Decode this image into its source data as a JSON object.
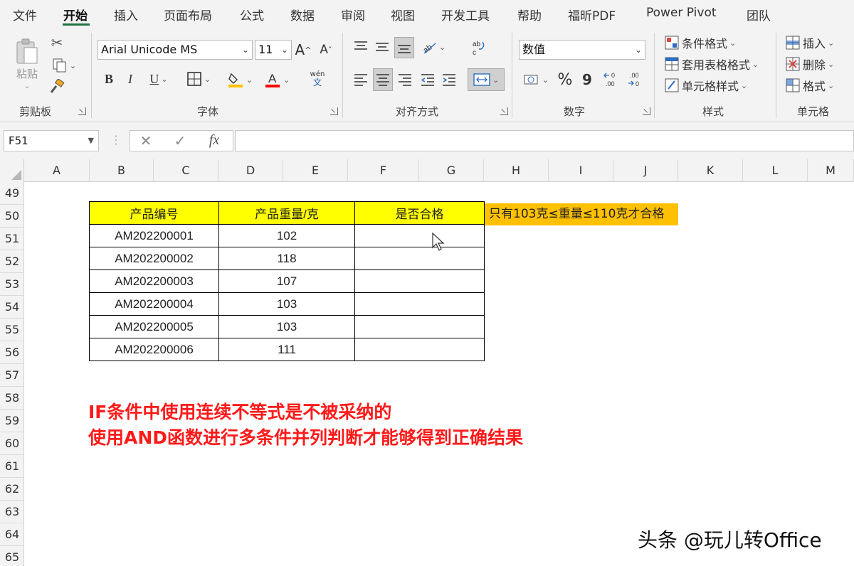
{
  "menu": {
    "tabs": [
      "文件",
      "开始",
      "插入",
      "页面布局",
      "公式",
      "数据",
      "审阅",
      "视图",
      "开发工具",
      "帮助",
      "福昕PDF",
      "Power Pivot",
      "团队"
    ],
    "active_index": 1
  },
  "ribbon": {
    "clipboard": {
      "group_label": "剪贴板",
      "paste_label": "粘贴"
    },
    "font": {
      "group_label": "字体",
      "font_name": "Arial Unicode MS",
      "font_size": "11",
      "bold": "B",
      "italic": "I",
      "underline": "U",
      "grow": "A",
      "shrink": "A",
      "wen": "wén",
      "wen_char": "文"
    },
    "alignment": {
      "group_label": "对齐方式"
    },
    "number": {
      "group_label": "数字",
      "format": "数值",
      "percent": "%",
      "comma": "9",
      "inc_decimal": "←0\n.00",
      "dec_decimal": ".00\n→0"
    },
    "styles": {
      "group_label": "样式",
      "conditional": "条件格式",
      "table": "套用表格格式",
      "cell_styles": "单元格样式"
    },
    "cells": {
      "group_label": "单元格",
      "insert": "插入",
      "delete": "删除",
      "format": "格式"
    }
  },
  "formula_bar": {
    "name_box": "F51",
    "fx": "fx",
    "value": ""
  },
  "columns": [
    "A",
    "B",
    "C",
    "D",
    "E",
    "F",
    "G",
    "H",
    "I",
    "J",
    "K",
    "L",
    "M"
  ],
  "rows": [
    "49",
    "50",
    "51",
    "52",
    "53",
    "54",
    "55",
    "56",
    "57",
    "58",
    "59",
    "60",
    "61",
    "62",
    "63",
    "64",
    "65"
  ],
  "table": {
    "headers": [
      "产品编号",
      "产品重量/克",
      "是否合格"
    ],
    "rows": [
      [
        "AM202200001",
        "102",
        ""
      ],
      [
        "AM202200002",
        "118",
        ""
      ],
      [
        "AM202200003",
        "107",
        ""
      ],
      [
        "AM202200004",
        "103",
        ""
      ],
      [
        "AM202200005",
        "103",
        ""
      ],
      [
        "AM202200006",
        "111",
        ""
      ]
    ]
  },
  "note": "只有103克≤重量≤110克才合格",
  "annotation": {
    "line1": "IF条件中使用连续不等式是不被采纳的",
    "line2": "使用AND函数进行多条件并列判断才能够得到正确结果"
  },
  "watermark": "头条 @玩儿转Office",
  "colors": {
    "header_fill": "#ffff00",
    "note_fill": "#ffc000",
    "annotation": "#ff1a1a",
    "accent": "#217346"
  }
}
